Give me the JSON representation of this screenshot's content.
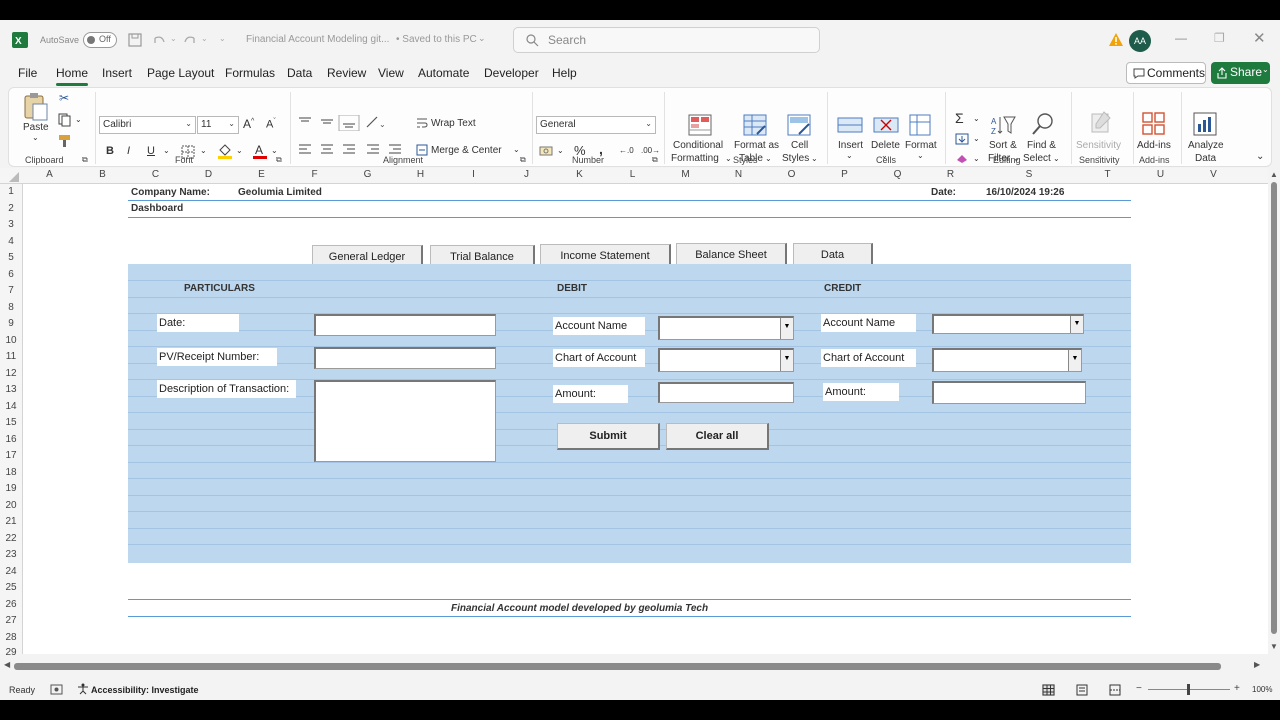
{
  "titlebar": {
    "autosave_label": "AutoSave",
    "autosave_state": "Off",
    "filename": "Financial Account Modeling git...",
    "save_status": "• Saved to this PC",
    "search_placeholder": "Search",
    "user_initials": "AA"
  },
  "menu": {
    "tabs": [
      "File",
      "Home",
      "Insert",
      "Page Layout",
      "Formulas",
      "Data",
      "Review",
      "View",
      "Automate",
      "Developer",
      "Help"
    ],
    "active": "Home",
    "comments": "Comments",
    "share": "Share"
  },
  "ribbon": {
    "clipboard": {
      "paste": "Paste",
      "group": "Clipboard"
    },
    "font": {
      "name": "Calibri",
      "size": "11",
      "group": "Font"
    },
    "alignment": {
      "wrap": "Wrap Text",
      "merge": "Merge & Center",
      "group": "Alignment"
    },
    "number": {
      "format": "General",
      "group": "Number"
    },
    "styles": {
      "cond1": "Conditional",
      "cond2": "Formatting",
      "fmt1": "Format as",
      "fmt2": "Table",
      "cell1": "Cell",
      "cell2": "Styles",
      "group": "Styles"
    },
    "cells": {
      "insert": "Insert",
      "delete": "Delete",
      "format": "Format",
      "group": "Cells"
    },
    "editing": {
      "sort1": "Sort &",
      "sort2": "Filter",
      "find1": "Find &",
      "find2": "Select",
      "group": "Editing"
    },
    "sensitivity": {
      "label": "Sensitivity",
      "group": "Sensitivity"
    },
    "addins": {
      "label": "Add-ins",
      "group": "Add-ins"
    },
    "analyze": {
      "l1": "Analyze",
      "l2": "Data"
    }
  },
  "columns": [
    "A",
    "B",
    "C",
    "D",
    "E",
    "F",
    "G",
    "H",
    "I",
    "J",
    "K",
    "L",
    "M",
    "N",
    "O",
    "P",
    "Q",
    "R",
    "S",
    "T",
    "U",
    "V"
  ],
  "rows": [
    "1",
    "2",
    "3",
    "4",
    "5",
    "6",
    "7",
    "8",
    "9",
    "10",
    "11",
    "12",
    "13",
    "14",
    "15",
    "16",
    "17",
    "18",
    "19",
    "20",
    "21",
    "22",
    "23",
    "24",
    "25",
    "26",
    "27",
    "28",
    "29"
  ],
  "sheet": {
    "company_label": "Company Name:",
    "company_value": "Geolumia Limited",
    "date_label": "Date:",
    "date_value": "16/10/2024 19:26",
    "dashboard": "Dashboard",
    "nav_buttons": [
      "General Ledger",
      "Trial Balance",
      "Income Statement",
      "Balance Sheet",
      "Data"
    ],
    "particulars": "PARTICULARS",
    "debit": "DEBIT",
    "credit": "CREDIT",
    "date_field_label": "Date:",
    "pv_label": "PV/Receipt Number:",
    "desc_label": "Description of Transaction:",
    "debit_account_name": "Account Name",
    "debit_chart": "Chart of Account",
    "debit_amount": "Amount:",
    "credit_account_name": "Account Name",
    "credit_chart": "Chart of Account",
    "credit_amount": "Amount:",
    "submit": "Submit",
    "clear": "Clear all",
    "footer": "Financial Account model developed by geolumia Tech"
  },
  "status": {
    "ready": "Ready",
    "accessibility": "Accessibility: Investigate",
    "zoom": "100%"
  }
}
